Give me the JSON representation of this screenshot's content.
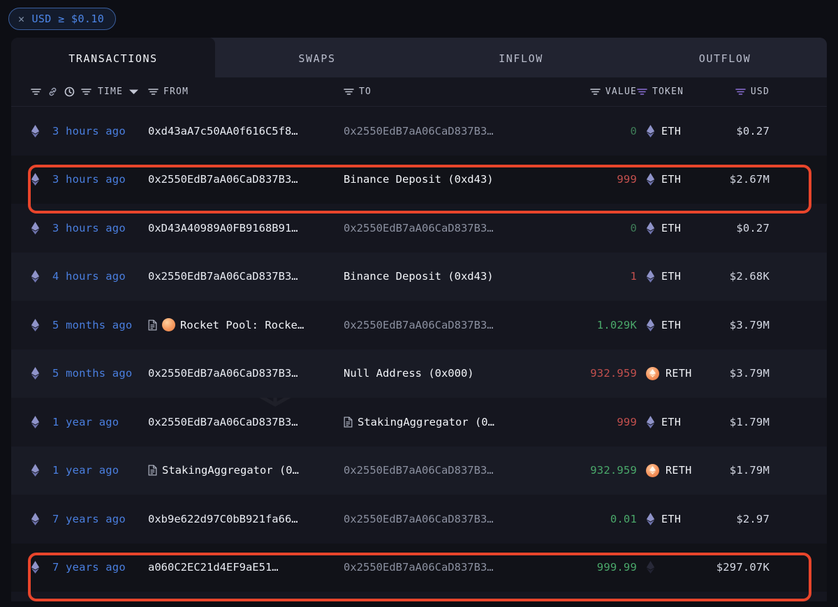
{
  "filter_chip": {
    "close_icon": "close-icon",
    "text": "USD ≥ $0.10"
  },
  "tabs": [
    {
      "label": "TRANSACTIONS",
      "active": true
    },
    {
      "label": "SWAPS",
      "active": false
    },
    {
      "label": "INFLOW",
      "active": false
    },
    {
      "label": "OUTFLOW",
      "active": false
    }
  ],
  "columns": {
    "chain_filter_icon": "filter-icon",
    "chain_icon": "link-icon",
    "time_clock_icon": "clock-icon",
    "time_filter_icon": "filter-icon",
    "time": "TIME",
    "time_sort_icon": "chevron-down-icon",
    "from_filter_icon": "filter-icon",
    "from": "FROM",
    "to_filter_icon": "filter-icon",
    "to": "TO",
    "value_filter_icon": "filter-icon",
    "value": "VALUE",
    "token_filter_icon": "filter-icon-active",
    "token": "TOKEN",
    "usd_filter_icon": "filter-icon-active",
    "usd": "USD"
  },
  "watermark": "ARKHAM",
  "rows": [
    {
      "chain_icon": "ethereum-icon",
      "time": "3 hours ago",
      "from": "0xd43aA7c50AA0f616C5f8…",
      "from_style": "own",
      "from_icon": null,
      "to": "0x2550EdB7aA06CaD837B3…",
      "to_style": "addr",
      "to_icon": null,
      "value": "0",
      "value_dir": "in",
      "token": "ETH",
      "token_icon": "ethereum-icon",
      "usd": "$0.27"
    },
    {
      "chain_icon": "ethereum-icon",
      "time": "3 hours ago",
      "from": "0x2550EdB7aA06CaD837B3…",
      "from_style": "own",
      "from_icon": null,
      "to": "Binance Deposit (0xd43)",
      "to_style": "label",
      "to_icon": null,
      "value": "999",
      "value_dir": "out",
      "token": "ETH",
      "token_icon": "ethereum-icon",
      "usd": "$2.67M",
      "highlighted": true
    },
    {
      "chain_icon": "ethereum-icon",
      "time": "3 hours ago",
      "from": "0xD43A40989A0FB9168B91…",
      "from_style": "own",
      "from_icon": null,
      "to": "0x2550EdB7aA06CaD837B3…",
      "to_style": "addr",
      "to_icon": null,
      "value": "0",
      "value_dir": "in",
      "token": "ETH",
      "token_icon": "ethereum-icon",
      "usd": "$0.27"
    },
    {
      "chain_icon": "ethereum-icon",
      "time": "4 hours ago",
      "from": "0x2550EdB7aA06CaD837B3…",
      "from_style": "own",
      "from_icon": null,
      "to": "Binance Deposit (0xd43)",
      "to_style": "label",
      "to_icon": null,
      "value": "1",
      "value_dir": "out",
      "token": "ETH",
      "token_icon": "ethereum-icon",
      "usd": "$2.68K"
    },
    {
      "chain_icon": "ethereum-icon",
      "time": "5 months ago",
      "from": "Rocket Pool: Rocke…",
      "from_style": "label",
      "from_icon": "contract-and-rocketpool-icon",
      "to": "0x2550EdB7aA06CaD837B3…",
      "to_style": "addr",
      "to_icon": null,
      "value": "1.029K",
      "value_dir": "in",
      "token": "ETH",
      "token_icon": "ethereum-icon",
      "usd": "$3.79M"
    },
    {
      "chain_icon": "ethereum-icon",
      "time": "5 months ago",
      "from": "0x2550EdB7aA06CaD837B3…",
      "from_style": "own",
      "from_icon": null,
      "to": "Null Address (0x000)",
      "to_style": "label",
      "to_icon": null,
      "value": "932.959",
      "value_dir": "out",
      "token": "RETH",
      "token_icon": "reth-icon",
      "usd": "$3.79M"
    },
    {
      "chain_icon": "ethereum-icon",
      "time": "1 year ago",
      "from": "0x2550EdB7aA06CaD837B3…",
      "from_style": "own",
      "from_icon": null,
      "to": "StakingAggregator (0…",
      "to_style": "label",
      "to_icon": "contract-icon",
      "value": "999",
      "value_dir": "out",
      "token": "ETH",
      "token_icon": "ethereum-icon",
      "usd": "$1.79M"
    },
    {
      "chain_icon": "ethereum-icon",
      "time": "1 year ago",
      "from": "StakingAggregator (0…",
      "from_style": "label",
      "from_icon": "contract-icon",
      "to": "0x2550EdB7aA06CaD837B3…",
      "to_style": "addr",
      "to_icon": null,
      "value": "932.959",
      "value_dir": "in",
      "token": "RETH",
      "token_icon": "reth-icon",
      "usd": "$1.79M"
    },
    {
      "chain_icon": "ethereum-icon",
      "time": "7 years ago",
      "from": "0xb9e622d97C0bB921fa66…",
      "from_style": "own",
      "from_icon": null,
      "to": "0x2550EdB7aA06CaD837B3…",
      "to_style": "addr",
      "to_icon": null,
      "value": "0.01",
      "value_dir": "in",
      "token": "ETH",
      "token_icon": "ethereum-icon",
      "usd": "$2.97"
    },
    {
      "chain_icon": "ethereum-icon",
      "time": "7 years ago",
      "from": "a060C2EC21d4EF9aE51…",
      "from_style": "own",
      "from_icon": null,
      "to": "0x2550EdB7aA06CaD837B3…",
      "to_style": "addr",
      "to_icon": null,
      "value": "999.99",
      "value_dir": "in",
      "token": "",
      "token_icon": "ethereum-icon",
      "token_faded": true,
      "usd": "$297.07K",
      "highlighted": true
    }
  ],
  "colors": {
    "accent_blue": "#4a7fe0",
    "highlight_red": "#e8452b",
    "inflow_green": "#4aa86a",
    "outflow_red": "#c4504e",
    "filter_purple": "#8b6fd6"
  }
}
